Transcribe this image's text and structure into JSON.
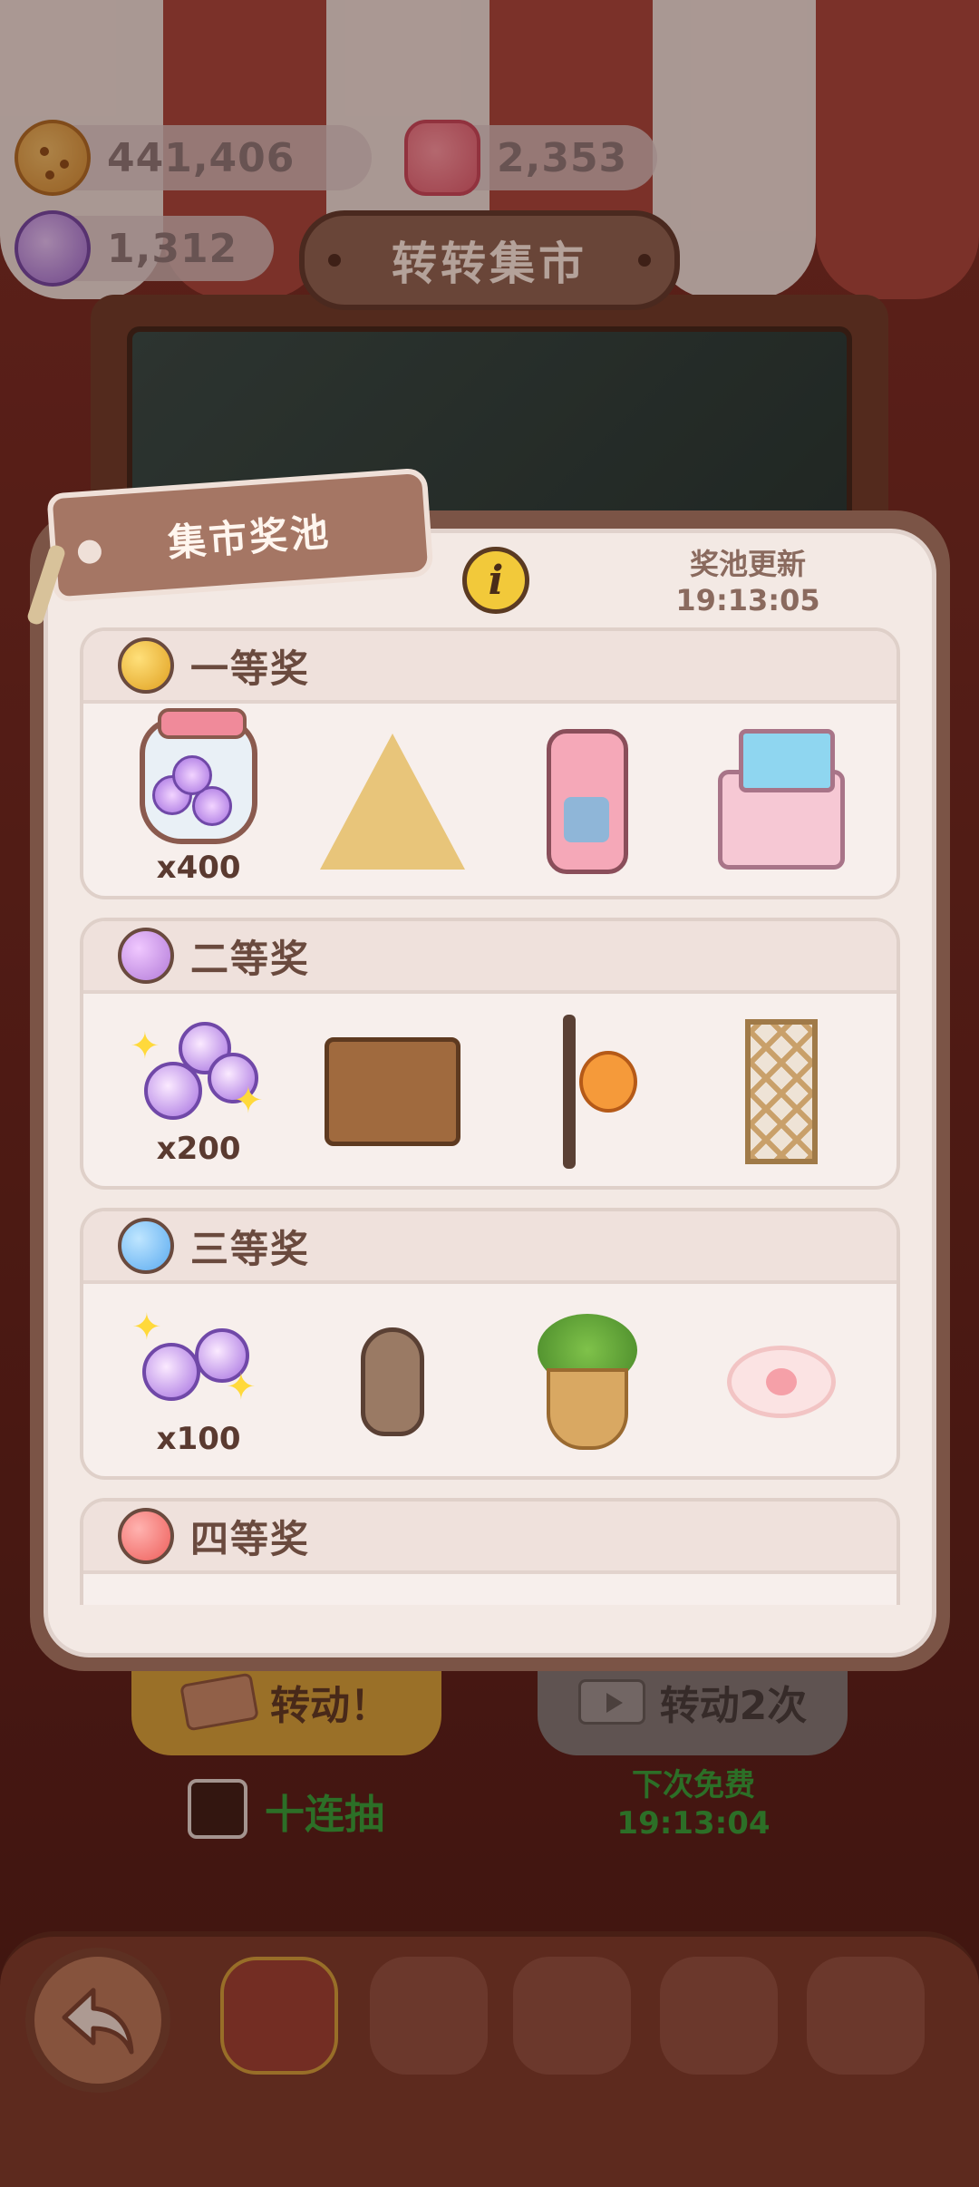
{
  "currencies": {
    "cookies": "441,406",
    "jelly": "2,353",
    "candy": "1,312"
  },
  "sign": {
    "title": "转转集市"
  },
  "modal": {
    "tag_title": "集市奖池",
    "info_icon": "i",
    "refresh_label": "奖池更新",
    "refresh_time": "19:13:05",
    "tiers": [
      {
        "title": "一等奖",
        "orb_color": "#f2b528",
        "items": [
          {
            "icon": "candy-jar-icon",
            "qty": "x400"
          },
          {
            "icon": "tent-icon",
            "qty": ""
          },
          {
            "icon": "vending-machine-icon",
            "qty": ""
          },
          {
            "icon": "computer-desk-icon",
            "qty": ""
          }
        ]
      },
      {
        "title": "二等奖",
        "orb_color": "#c08ae0",
        "items": [
          {
            "icon": "candy-pile-icon",
            "qty": "x200"
          },
          {
            "icon": "writing-desk-icon",
            "qty": ""
          },
          {
            "icon": "lantern-stand-icon",
            "qty": ""
          },
          {
            "icon": "flower-trellis-icon",
            "qty": ""
          }
        ]
      },
      {
        "title": "三等奖",
        "orb_color": "#6ab4f2",
        "items": [
          {
            "icon": "candy-pile-icon",
            "qty": "x100"
          },
          {
            "icon": "owl-windchime-icon",
            "qty": ""
          },
          {
            "icon": "potted-plant-icon",
            "qty": ""
          },
          {
            "icon": "paw-rug-icon",
            "qty": ""
          }
        ]
      },
      {
        "title": "四等奖",
        "orb_color": "#ee6a66",
        "items": []
      }
    ]
  },
  "actions": {
    "spin_label": "转动！",
    "spin_twice_label": "转动2次",
    "ten_pull_label": "十连抽",
    "next_free_label": "下次免费",
    "next_free_time": "19:13:04"
  },
  "nav": {
    "items": [
      "back-icon",
      "market-icon",
      "bunny-icon",
      "mushroom-house-icon",
      "tea-icon",
      "recycle-icon"
    ]
  }
}
